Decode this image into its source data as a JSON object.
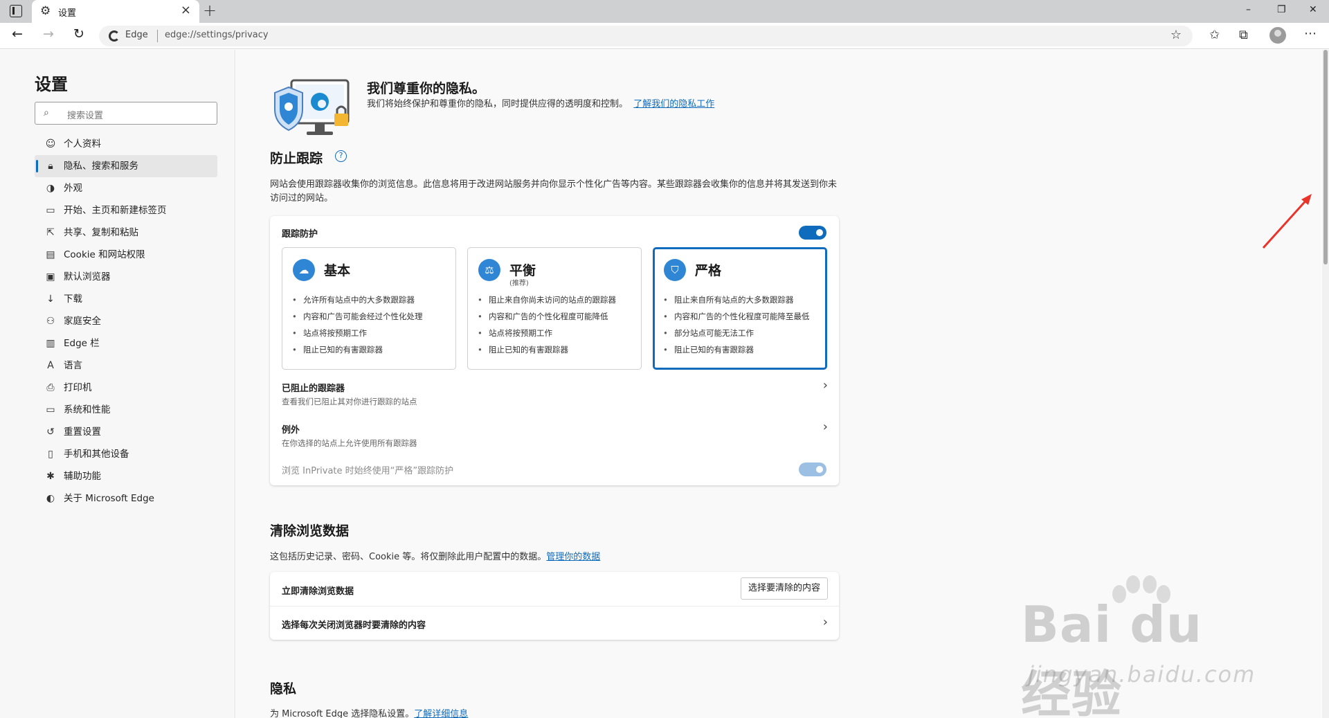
{
  "window": {
    "tab_title": "设置",
    "minimize": "–",
    "restore": "❐",
    "close": "✕"
  },
  "address_bar": {
    "site_label": "Edge",
    "url": "edge://settings/privacy"
  },
  "sidebar": {
    "title": "设置",
    "search_placeholder": "搜索设置",
    "items": [
      {
        "label": "个人资料",
        "icon": "profile-icon"
      },
      {
        "label": "隐私、搜索和服务",
        "icon": "lock-icon",
        "active": true
      },
      {
        "label": "外观",
        "icon": "appearance-icon"
      },
      {
        "label": "开始、主页和新建标签页",
        "icon": "home-icon"
      },
      {
        "label": "共享、复制和粘贴",
        "icon": "share-icon"
      },
      {
        "label": "Cookie 和网站权限",
        "icon": "cookie-icon"
      },
      {
        "label": "默认浏览器",
        "icon": "browser-icon"
      },
      {
        "label": "下载",
        "icon": "download-icon"
      },
      {
        "label": "家庭安全",
        "icon": "family-icon"
      },
      {
        "label": "Edge 栏",
        "icon": "edge-bar-icon"
      },
      {
        "label": "语言",
        "icon": "language-icon"
      },
      {
        "label": "打印机",
        "icon": "printer-icon"
      },
      {
        "label": "系统和性能",
        "icon": "system-icon"
      },
      {
        "label": "重置设置",
        "icon": "reset-icon"
      },
      {
        "label": "手机和其他设备",
        "icon": "phone-icon"
      },
      {
        "label": "辅助功能",
        "icon": "accessibility-icon"
      },
      {
        "label": "关于 Microsoft Edge",
        "icon": "edge-logo-icon"
      }
    ]
  },
  "hero": {
    "title": "我们尊重你的隐私。",
    "desc": "我们将始终保护和尊重你的隐私，同时提供应得的透明度和控制。",
    "link": "了解我们的隐私工作"
  },
  "tracking": {
    "title": "防止跟踪",
    "desc": "网站会使用跟踪器收集你的浏览信息。此信息将用于改进网站服务并向你显示个性化广告等内容。某些跟踪器会收集你的信息并将其发送到你未访问过的网站。",
    "protection_label": "跟踪防护",
    "protection_on": true,
    "options": [
      {
        "name": "基本",
        "sub": "",
        "icon": "basic-icon",
        "bullets": [
          "允许所有站点中的大多数跟踪器",
          "内容和广告可能会经过个性化处理",
          "站点将按预期工作",
          "阻止已知的有害跟踪器"
        ]
      },
      {
        "name": "平衡",
        "sub": "(推荐)",
        "icon": "balance-icon",
        "bullets": [
          "阻止来自你尚未访问的站点的跟踪器",
          "内容和广告的个性化程度可能降低",
          "站点将按预期工作",
          "阻止已知的有害跟踪器"
        ]
      },
      {
        "name": "严格",
        "sub": "",
        "icon": "shield-icon",
        "selected": true,
        "bullets": [
          "阻止来自所有站点的大多数跟踪器",
          "内容和广告的个性化程度可能降至最低",
          "部分站点可能无法工作",
          "阻止已知的有害跟踪器"
        ]
      }
    ],
    "blocked_title": "已阻止的跟踪器",
    "blocked_desc": "查看我们已阻止其对你进行跟踪的站点",
    "exceptions_title": "例外",
    "exceptions_desc": "在你选择的站点上允许使用所有跟踪器",
    "inprivate_label": "浏览 InPrivate 时始终使用“严格”跟踪防护"
  },
  "clear": {
    "title": "清除浏览数据",
    "desc": "这包括历史记录、密码、Cookie 等。将仅删除此用户配置中的数据。",
    "link": "管理你的数据",
    "now_label": "立即清除浏览数据",
    "button": "选择要清除的内容",
    "on_close_label": "选择每次关闭浏览器时要清除的内容"
  },
  "privacy": {
    "title": "隐私",
    "desc": "为 Microsoft Edge 选择隐私设置。",
    "link": "了解详细信息"
  },
  "watermark": {
    "main": "Bai du 经验",
    "sub": "jingyan.baidu.com"
  },
  "colors": {
    "accent": "#0f6cbd",
    "annotation_arrow": "#e8342a"
  }
}
